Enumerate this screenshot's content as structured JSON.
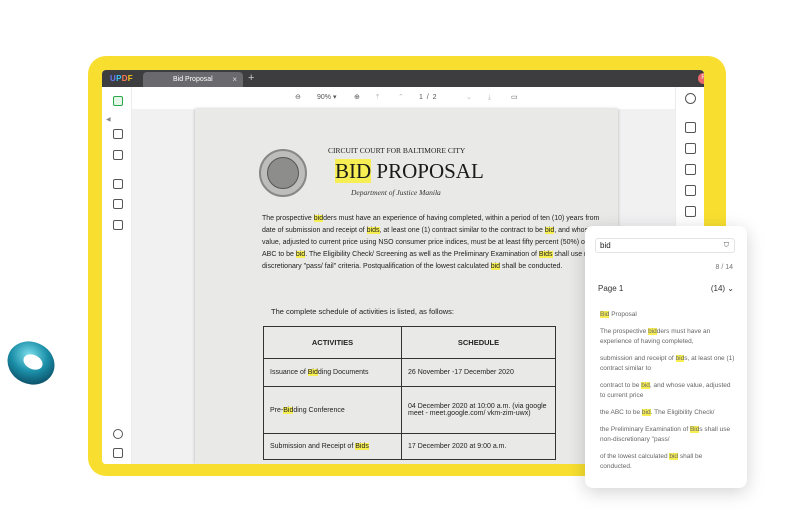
{
  "app": {
    "logo": [
      "U",
      "P",
      "D",
      "F"
    ],
    "tab_title": "Bid Proposal",
    "tab_close": "×",
    "tab_add": "+",
    "user_initial": "R"
  },
  "toolbar": {
    "zoom": "90%",
    "zoom_arrow": "▾",
    "page_current": "1",
    "page_sep": "/",
    "page_total": "2"
  },
  "document": {
    "court": "CIRCUIT COURT FOR BALTIMORE CITY",
    "title_hl": "BID",
    "title_rest": " PROPOSAL",
    "dept": "Department of Justice Manila",
    "para": [
      {
        "t": "The prospective "
      },
      {
        "t": "bid",
        "hl": true
      },
      {
        "t": "ders must have an experience of having completed, within a period of ten (10) years from date of submission and receipt of "
      },
      {
        "t": "bids",
        "hl": true
      },
      {
        "t": ", at least one (1) contract similar to the contract to be "
      },
      {
        "t": "bid",
        "hl": true
      },
      {
        "t": ", and whose value, adjusted to current price using NSO consumer price indices, must be at least fifty percent (50%) of the ABC to be "
      },
      {
        "t": "bid",
        "hl": true
      },
      {
        "t": ". The Eligibility Check/ Screening as well as the Preliminary Examination of "
      },
      {
        "t": "Bids",
        "hl": true
      },
      {
        "t": " shall use non-discretionary \"pass/ fail\" criteria. Postqualification of the lowest calculated "
      },
      {
        "t": "bid",
        "hl": true
      },
      {
        "t": " shall be conducted."
      }
    ],
    "schedule_intro": "The complete schedule of activities is listed, as follows:",
    "table_headers": [
      "ACTIVITIES",
      "SCHEDULE"
    ],
    "rows": [
      {
        "activity": [
          {
            "t": "Issuance of "
          },
          {
            "t": "Bid",
            "hl": true
          },
          {
            "t": "ding Documents"
          }
        ],
        "schedule": "26 November -17 December 2020"
      },
      {
        "activity": [
          {
            "t": "Pre-"
          },
          {
            "t": "Bid",
            "hl": true
          },
          {
            "t": "ding Conference"
          }
        ],
        "schedule": "04 December 2020 at 10:00 a.m. (via google meet - meet.google.com/ vkm-zim-uwx)"
      },
      {
        "activity": [
          {
            "t": "Submission and Receipt of "
          },
          {
            "t": "Bids",
            "hl": true
          }
        ],
        "schedule": "17 December 2020 at 9:00 a.m."
      }
    ]
  },
  "search": {
    "query": "bid",
    "count": "8 / 14",
    "page_label": "Page 1",
    "page_count": "(14)",
    "results": [
      [
        {
          "t": "Bid",
          "hl": true
        },
        {
          "t": " Proposal"
        }
      ],
      [
        {
          "t": "The prospective "
        },
        {
          "t": "bid",
          "hl": true
        },
        {
          "t": "ders must have an experience of having completed,"
        }
      ],
      [
        {
          "t": "submission and receipt of "
        },
        {
          "t": "bid",
          "hl": true
        },
        {
          "t": "s, at least one (1) contract similar to"
        }
      ],
      [
        {
          "t": "contract to be "
        },
        {
          "t": "bid",
          "hl": true
        },
        {
          "t": ", and whose value, adjusted to current price"
        }
      ],
      [
        {
          "t": "the ABC to be "
        },
        {
          "t": "bid",
          "hl": true
        },
        {
          "t": ". The Eligibility Check/"
        }
      ],
      [
        {
          "t": "the Preliminary Examination of "
        },
        {
          "t": "Bid",
          "hl": true
        },
        {
          "t": "s shall use non-discretionary \"pass/"
        }
      ],
      [
        {
          "t": "of the lowest calculated "
        },
        {
          "t": "bid",
          "hl": true
        },
        {
          "t": " shall be conducted."
        }
      ]
    ]
  },
  "colors": {
    "frame": "#f8df2f",
    "highlight": "#f6ee53",
    "torus": "#1b8fa8"
  },
  "icons": {
    "left": [
      "reader-icon",
      "edit-text-icon",
      "comment-icon",
      "organize-pages-icon",
      "form-icon",
      "ocr-icon",
      "layers-icon",
      "bookmark-icon"
    ],
    "right": [
      "search-icon",
      "ocr-icon",
      "convert-pdf-icon",
      "pdfa-icon",
      "protect-icon",
      "share-icon"
    ]
  }
}
